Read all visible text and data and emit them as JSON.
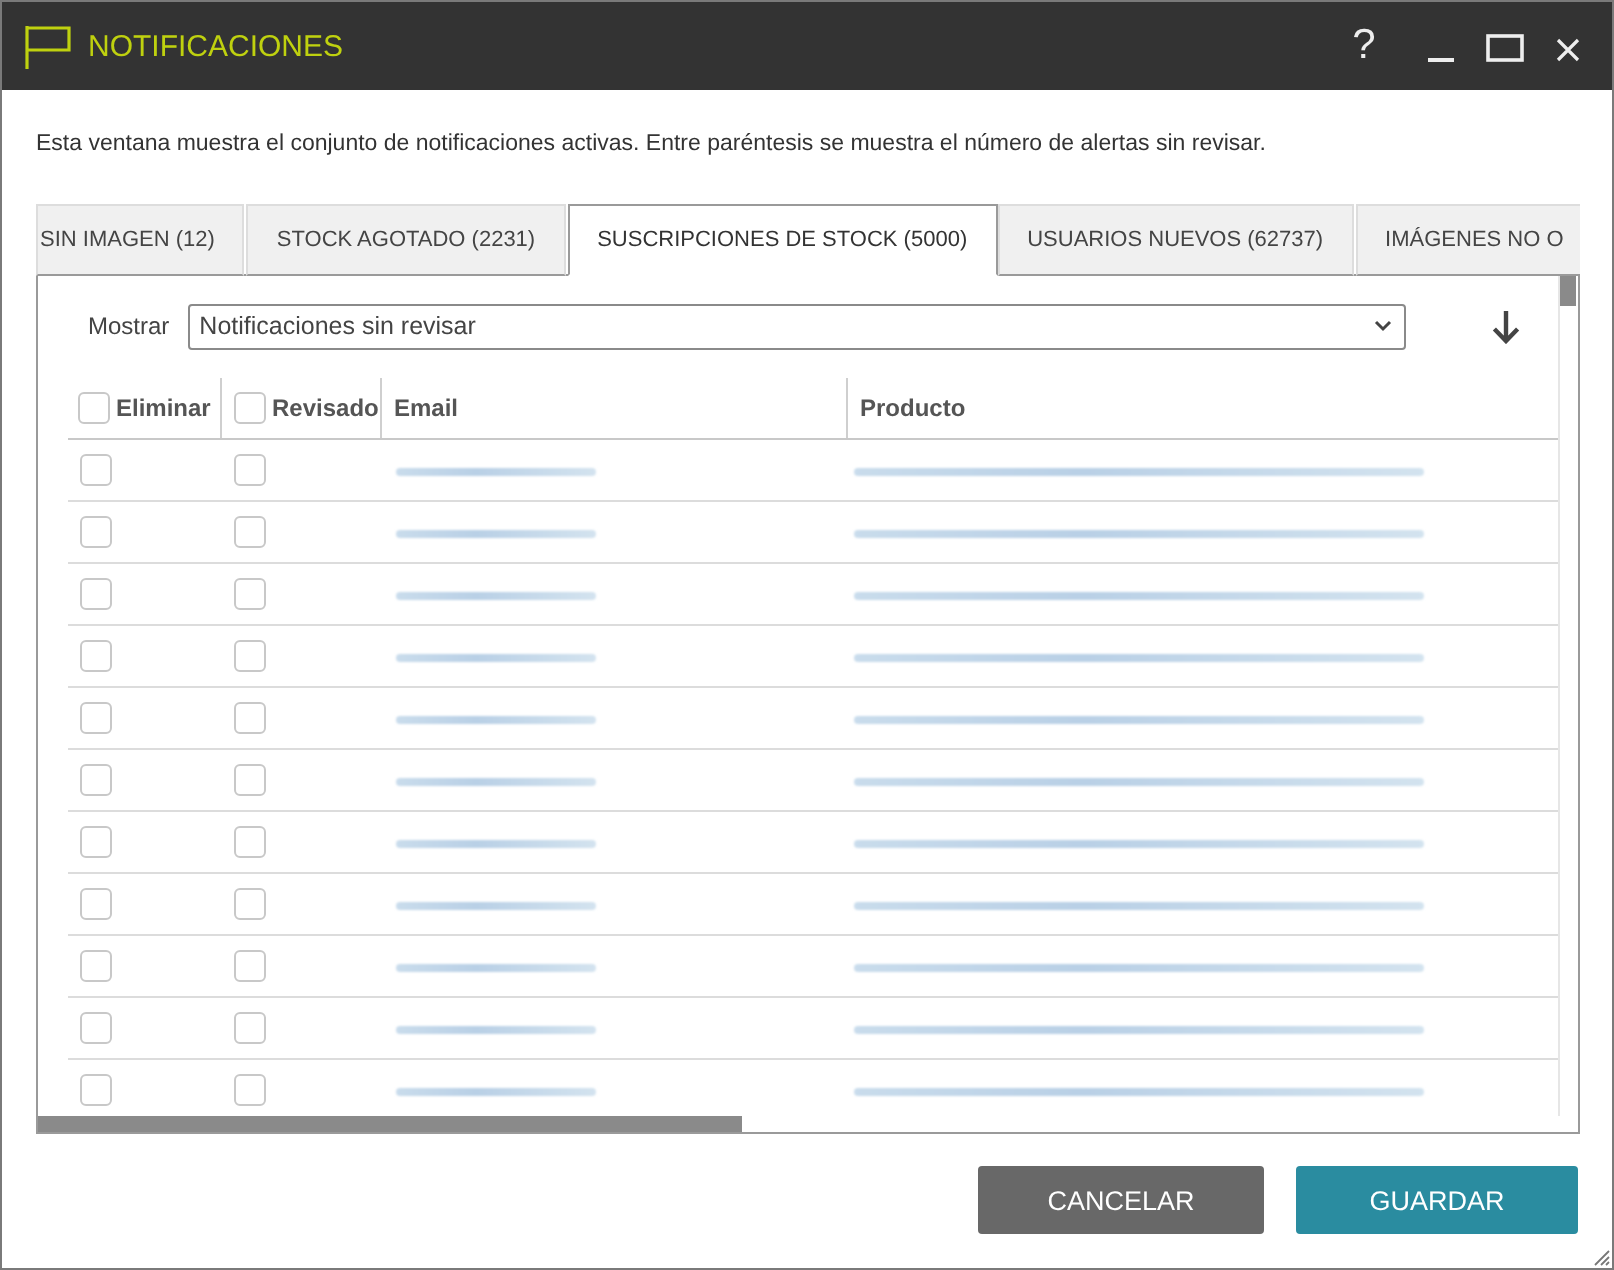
{
  "window": {
    "title": "NOTIFICACIONES",
    "help": "?"
  },
  "description": "Esta ventana muestra el conjunto de notificaciones activas. Entre paréntesis se muestra el número de alertas sin revisar.",
  "tabs": [
    {
      "label": "SIN IMAGEN (12)",
      "selected": false
    },
    {
      "label": "STOCK AGOTADO (2231)",
      "selected": false
    },
    {
      "label": "SUSCRIPCIONES DE STOCK (5000)",
      "selected": true
    },
    {
      "label": "USUARIOS NUEVOS (62737)",
      "selected": false
    },
    {
      "label": "IMÁGENES NO O",
      "selected": false
    }
  ],
  "filter": {
    "label": "Mostrar",
    "value": "Notificaciones sin revisar"
  },
  "table": {
    "columns": [
      {
        "label": "Eliminar",
        "kind": "checkbox",
        "checked": false
      },
      {
        "label": "Revisado",
        "kind": "checkbox",
        "checked": false
      },
      {
        "label": "Email",
        "kind": "text"
      },
      {
        "label": "Producto",
        "kind": "text"
      }
    ],
    "rows": [
      {
        "delete_checked": false,
        "reviewed_checked": false
      },
      {
        "delete_checked": false,
        "reviewed_checked": false
      },
      {
        "delete_checked": false,
        "reviewed_checked": false
      },
      {
        "delete_checked": false,
        "reviewed_checked": false
      },
      {
        "delete_checked": false,
        "reviewed_checked": false
      },
      {
        "delete_checked": false,
        "reviewed_checked": false
      },
      {
        "delete_checked": false,
        "reviewed_checked": false
      },
      {
        "delete_checked": false,
        "reviewed_checked": false
      },
      {
        "delete_checked": false,
        "reviewed_checked": false
      },
      {
        "delete_checked": false,
        "reviewed_checked": false
      },
      {
        "delete_checked": false,
        "reviewed_checked": false
      }
    ]
  },
  "buttons": [
    {
      "label": "CANCELAR",
      "kind": "secondary"
    },
    {
      "label": "GUARDAR",
      "kind": "primary"
    }
  ]
}
